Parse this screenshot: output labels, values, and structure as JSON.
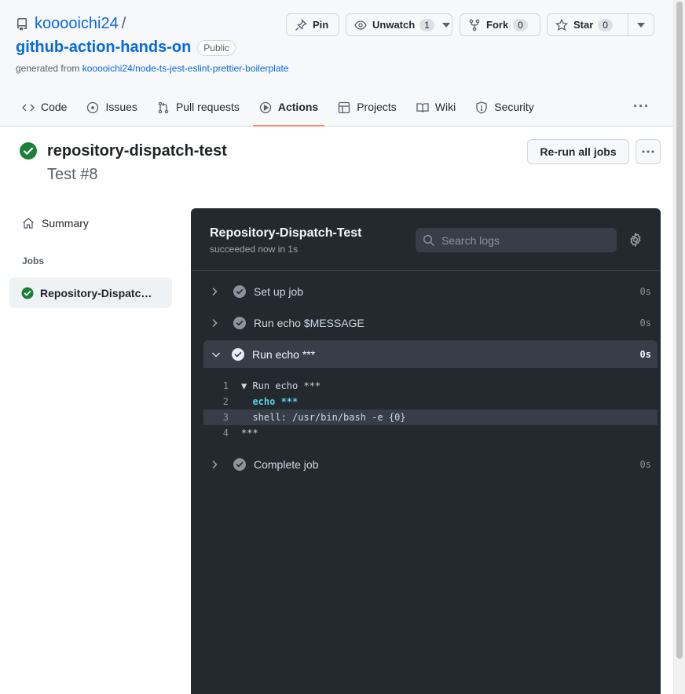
{
  "repo": {
    "owner": "kooooichi24",
    "slash": "/",
    "name": "github-action-hands-on",
    "visibility": "Public",
    "generated_from_prefix": "generated from ",
    "generated_from_link": "kooooichi24/node-ts-jest-eslint-prettier-boilerplate"
  },
  "repo_actions": {
    "pin": "Pin",
    "unwatch": "Unwatch",
    "watch_count": "1",
    "fork": "Fork",
    "fork_count": "0",
    "star": "Star",
    "star_count": "0"
  },
  "tabs": [
    {
      "label": "Code",
      "icon": "code-icon"
    },
    {
      "label": "Issues",
      "icon": "issue-opened-icon"
    },
    {
      "label": "Pull requests",
      "icon": "git-pull-request-icon"
    },
    {
      "label": "Actions",
      "icon": "play-icon",
      "active": true
    },
    {
      "label": "Projects",
      "icon": "table-icon"
    },
    {
      "label": "Wiki",
      "icon": "book-icon"
    },
    {
      "label": "Security",
      "icon": "shield-icon"
    }
  ],
  "run": {
    "title": "repository-dispatch-test",
    "subtitle": "Test #8",
    "rerun_label": "Re-run all jobs"
  },
  "sidebar": {
    "summary": "Summary",
    "jobs_heading": "Jobs",
    "job_label": "Repository-Dispatch-Test"
  },
  "logs": {
    "job_title": "Repository-Dispatch-Test",
    "status": "succeeded now in 1s",
    "search_placeholder": "Search logs",
    "steps": [
      {
        "name": "Set up job",
        "duration": "0s"
      },
      {
        "name": "Run echo $MESSAGE",
        "duration": "0s"
      },
      {
        "name": "Run echo ***",
        "duration": "0s"
      },
      {
        "name": "Complete job",
        "duration": "0s"
      }
    ],
    "lines": [
      {
        "n": "1",
        "text": "▼ Run echo ***"
      },
      {
        "n": "2",
        "text": "  echo ***"
      },
      {
        "n": "3",
        "text": "  shell: /usr/bin/bash -e {0}"
      },
      {
        "n": "4",
        "text": "***"
      }
    ]
  },
  "colors": {
    "accent_link": "#0969da",
    "success": "#1a7f37",
    "log_bg": "#24292f",
    "active_tab_underline": "#fd8c73"
  }
}
